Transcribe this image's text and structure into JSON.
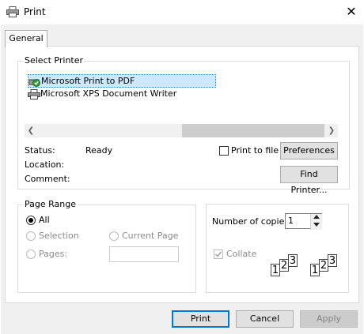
{
  "window": {
    "title": "Print",
    "close_glyph": "✕"
  },
  "tabs": [
    {
      "label": "General"
    }
  ],
  "select_printer": {
    "legend": "Select Printer",
    "printers": [
      {
        "name": "Microsoft Print to PDF",
        "selected": true
      },
      {
        "name": "Microsoft XPS Document Writer",
        "selected": false
      }
    ],
    "status_label": "Status:",
    "status_value": "Ready",
    "location_label": "Location:",
    "comment_label": "Comment:",
    "print_to_file_label": "Print to file",
    "print_to_file_checked": false,
    "preferences_label": "Preferences",
    "find_printer_label": "Find Printer..."
  },
  "page_range": {
    "legend": "Page Range",
    "all_label": "All",
    "selection_label": "Selection",
    "current_page_label": "Current Page",
    "pages_label": "Pages:",
    "pages_value": "",
    "selected_option": "All"
  },
  "copies": {
    "label": "Number of copies:",
    "value": "1",
    "collate_label": "Collate",
    "collate_checked": true,
    "collate_pages": [
      "1",
      "2",
      "3"
    ]
  },
  "footer": {
    "print_label": "Print",
    "cancel_label": "Cancel",
    "apply_label": "Apply"
  },
  "colors": {
    "accent": "#0078d7",
    "selection_bg": "#cce8ff",
    "dialog_bg": "#f0f0f0"
  }
}
